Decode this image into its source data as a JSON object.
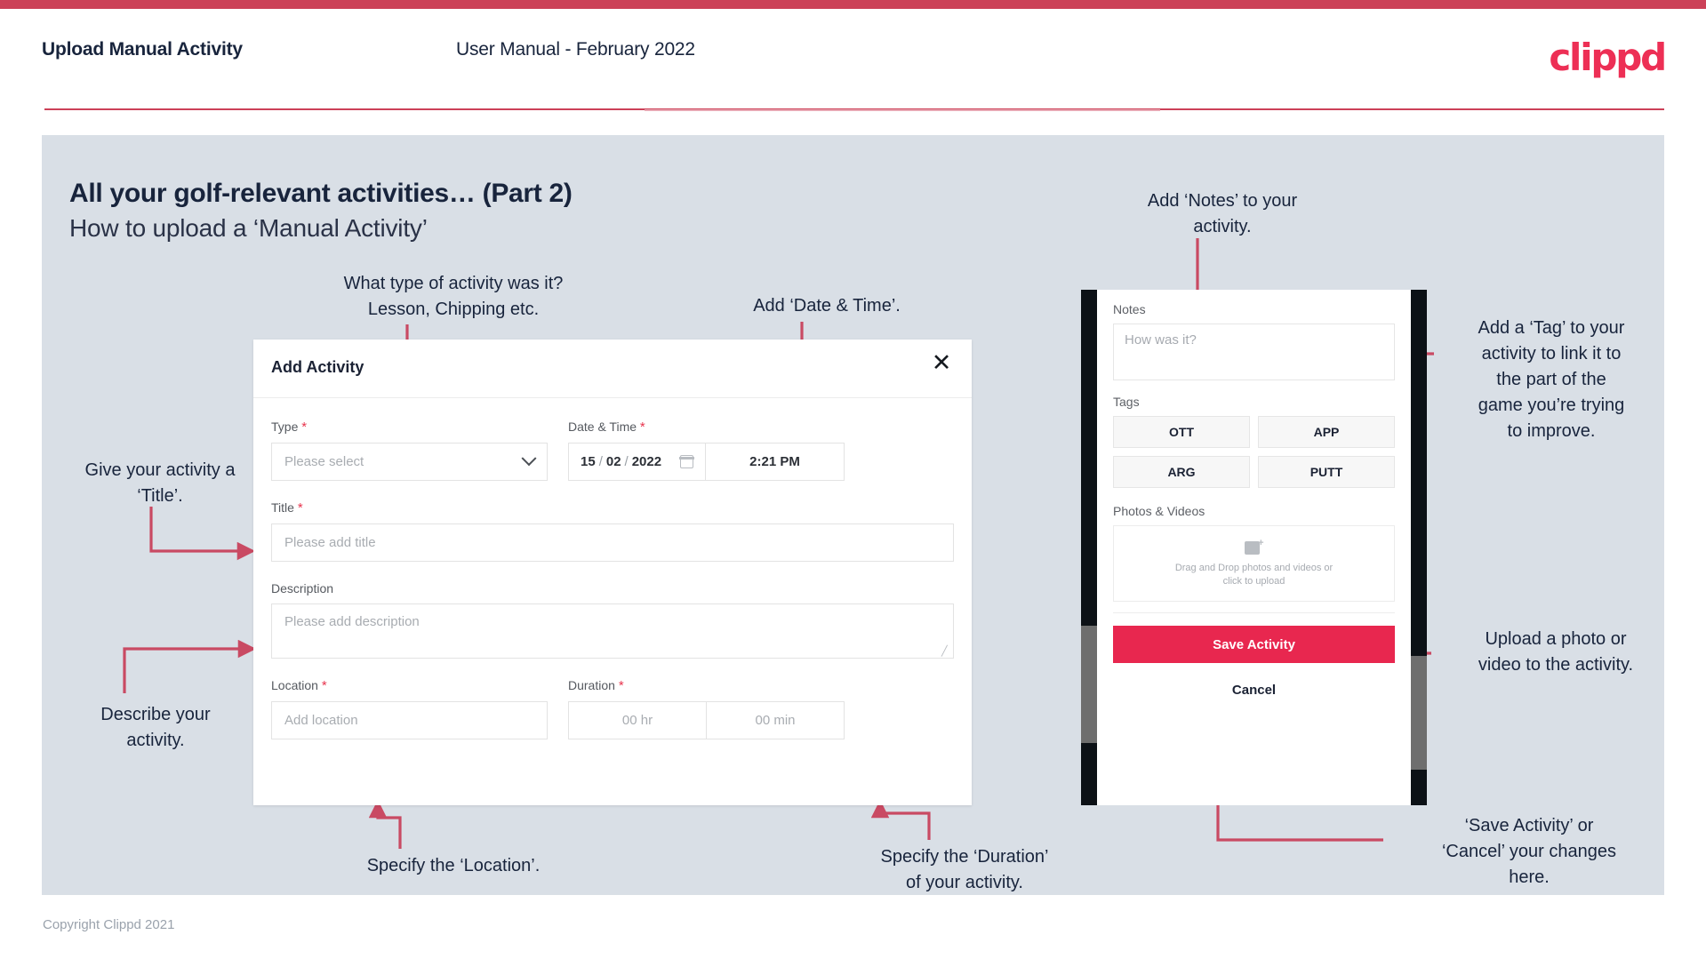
{
  "header": {
    "title": "Upload Manual Activity",
    "subtitle": "User Manual - February 2022",
    "logo": "clippd"
  },
  "slide": {
    "title": "All your golf-relevant activities… (Part 2)",
    "subtitle": "How to upload a ‘Manual Activity’"
  },
  "annotations": {
    "type": "What type of activity was it?\nLesson, Chipping etc.",
    "date_time": "Add ‘Date & Time’.",
    "title": "Give your activity a\n‘Title’.",
    "description": "Describe your\nactivity.",
    "location": "Specify the ‘Location’.",
    "duration": "Specify the ‘Duration’\nof your activity.",
    "notes": "Add ‘Notes’ to your\nactivity.",
    "tags": "Add a ‘Tag’ to your\nactivity to link it to\nthe part of the\ngame you’re trying\nto improve.",
    "photos": "Upload a photo or\nvideo to the activity.",
    "save_cancel": "‘Save Activity’ or\n‘Cancel’ your changes\nhere."
  },
  "dialog": {
    "title": "Add Activity",
    "close_icon": "close-icon",
    "fields": {
      "type": {
        "label": "Type",
        "required": "*",
        "placeholder": "Please select",
        "icon": "chevron-down-icon"
      },
      "date_time": {
        "label": "Date & Time",
        "required": "*",
        "day": "15",
        "month": "02",
        "year": "2022",
        "sep": "/",
        "time": "2:21 PM",
        "icon": "calendar-icon"
      },
      "title": {
        "label": "Title",
        "required": "*",
        "placeholder": "Please add title"
      },
      "description": {
        "label": "Description",
        "required": "",
        "placeholder": "Please add description"
      },
      "location": {
        "label": "Location",
        "required": "*",
        "placeholder": "Add location"
      },
      "duration": {
        "label": "Duration",
        "required": "*",
        "hours_placeholder": "00 hr",
        "minutes_placeholder": "00 min"
      }
    }
  },
  "phone": {
    "notes": {
      "label": "Notes",
      "placeholder": "How was it?"
    },
    "tags": {
      "label": "Tags",
      "items": [
        "OTT",
        "APP",
        "ARG",
        "PUTT"
      ]
    },
    "photos": {
      "label": "Photos & Videos",
      "dropzone_line1": "Drag and Drop photos and videos or",
      "dropzone_line2": "click to upload",
      "icon": "add-image-icon"
    },
    "save_label": "Save Activity",
    "cancel_label": "Cancel"
  },
  "footer": {
    "copyright": "Copyright Clippd 2021"
  },
  "colors": {
    "brand_crimson": "#cc4158",
    "logo_pink": "#ed2f55",
    "save_pink": "#e8274f",
    "slide_bg": "#d9dfe6",
    "ink": "#18243c",
    "arrow": "#c94a63"
  }
}
